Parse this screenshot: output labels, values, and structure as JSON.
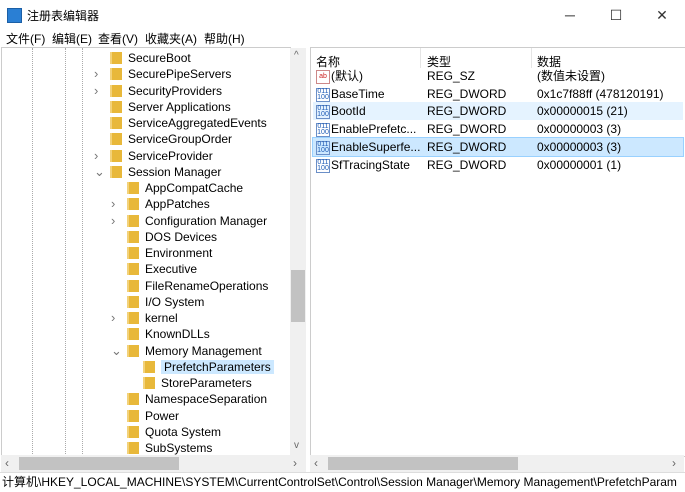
{
  "window": {
    "title": "注册表编辑器",
    "minimize": "─",
    "maximize": "☐",
    "close": "✕"
  },
  "menu": [
    "文件(F)",
    "编辑(E)",
    "查看(V)",
    "收藏夹(A)",
    "帮助(H)"
  ],
  "tree": [
    {
      "label": "SecureBoot",
      "level": 1,
      "chev": ""
    },
    {
      "label": "SecurePipeServers",
      "level": 1,
      "chev": ">"
    },
    {
      "label": "SecurityProviders",
      "level": 1,
      "chev": ">"
    },
    {
      "label": "Server Applications",
      "level": 1,
      "chev": ""
    },
    {
      "label": "ServiceAggregatedEvents",
      "level": 1,
      "chev": ""
    },
    {
      "label": "ServiceGroupOrder",
      "level": 1,
      "chev": ""
    },
    {
      "label": "ServiceProvider",
      "level": 1,
      "chev": ">"
    },
    {
      "label": "Session Manager",
      "level": 1,
      "chev": "v"
    },
    {
      "label": "AppCompatCache",
      "level": 2,
      "chev": ""
    },
    {
      "label": "AppPatches",
      "level": 2,
      "chev": ">"
    },
    {
      "label": "Configuration Manager",
      "level": 2,
      "chev": ">"
    },
    {
      "label": "DOS Devices",
      "level": 2,
      "chev": ""
    },
    {
      "label": "Environment",
      "level": 2,
      "chev": ""
    },
    {
      "label": "Executive",
      "level": 2,
      "chev": ""
    },
    {
      "label": "FileRenameOperations",
      "level": 2,
      "chev": ""
    },
    {
      "label": "I/O System",
      "level": 2,
      "chev": ""
    },
    {
      "label": "kernel",
      "level": 2,
      "chev": ">"
    },
    {
      "label": "KnownDLLs",
      "level": 2,
      "chev": ""
    },
    {
      "label": "Memory Management",
      "level": 2,
      "chev": "v"
    },
    {
      "label": "PrefetchParameters",
      "level": 3,
      "chev": "",
      "selected": true
    },
    {
      "label": "StoreParameters",
      "level": 3,
      "chev": ""
    },
    {
      "label": "NamespaceSeparation",
      "level": 2,
      "chev": ""
    },
    {
      "label": "Power",
      "level": 2,
      "chev": ""
    },
    {
      "label": "Quota System",
      "level": 2,
      "chev": ""
    },
    {
      "label": "SubSystems",
      "level": 2,
      "chev": ""
    }
  ],
  "list": {
    "headers": {
      "name": "名称",
      "type": "类型",
      "data": "数据"
    },
    "rows": [
      {
        "icon": "ab",
        "name": "(默认)",
        "type": "REG_SZ",
        "data": "(数值未设置)"
      },
      {
        "icon": "bin",
        "name": "BaseTime",
        "type": "REG_DWORD",
        "data": "0x1c7f88ff (478120191)"
      },
      {
        "icon": "bin",
        "name": "BootId",
        "type": "REG_DWORD",
        "data": "0x00000015 (21)",
        "hover": true
      },
      {
        "icon": "bin",
        "name": "EnablePrefetc...",
        "type": "REG_DWORD",
        "data": "0x00000003 (3)"
      },
      {
        "icon": "bin",
        "name": "EnableSuperfe...",
        "type": "REG_DWORD",
        "data": "0x00000003 (3)",
        "selected": true
      },
      {
        "icon": "bin",
        "name": "SfTracingState",
        "type": "REG_DWORD",
        "data": "0x00000001 (1)"
      }
    ]
  },
  "statusbar": "计算机\\HKEY_LOCAL_MACHINE\\SYSTEM\\CurrentControlSet\\Control\\Session Manager\\Memory Management\\PrefetchParam"
}
